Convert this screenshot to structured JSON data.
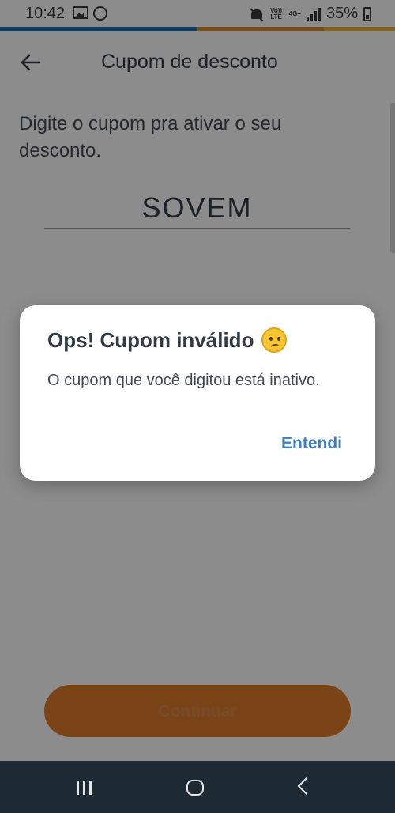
{
  "status_bar": {
    "time": "10:42",
    "battery": "35%",
    "network_tag_1": "Vo)) LTE",
    "network_tag_2": "4G+",
    "icons": [
      "gallery-icon",
      "whatsapp-icon",
      "mute-icon",
      "signal-icon",
      "battery-icon"
    ]
  },
  "accent_colors": [
    "#1b6fb6",
    "#e08a2c",
    "#f0b33a"
  ],
  "header": {
    "title": "Cupom de desconto",
    "back_icon": "back-arrow-icon"
  },
  "main": {
    "instruction": "Digite o cupom pra ativar o seu desconto.",
    "coupon_value": "SOVEM",
    "continue_label": "Continuar"
  },
  "dialog": {
    "title": "Ops! Cupom inválido",
    "title_icon": "confused-face-emoji",
    "message": "O cupom que você digitou está inativo.",
    "action_label": "Entendi"
  },
  "nav_bar": {
    "icons": [
      "recents-icon",
      "home-icon",
      "back-icon"
    ]
  },
  "colors": {
    "primary_orange": "#e07c28",
    "link_blue": "#3b7ec1",
    "text_dark": "#2f3c48",
    "nav_bg": "#1e2a33"
  }
}
